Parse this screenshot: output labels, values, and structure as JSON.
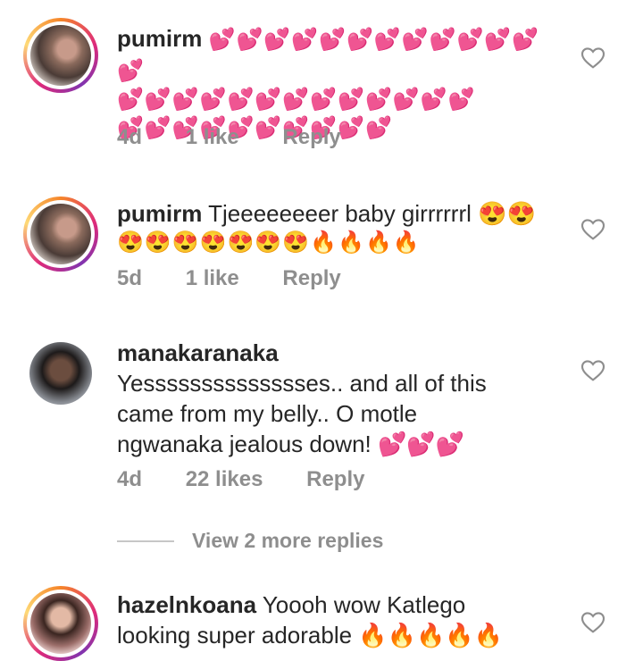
{
  "comments": [
    {
      "username": "pumirm",
      "text": "",
      "emoji_lines": [
        "💕💕💕💕💕💕💕💕💕💕💕💕💕",
        "💕💕💕💕💕💕💕💕💕💕💕💕💕",
        "💕💕💕💕💕💕💕💕💕💕"
      ],
      "time": "4d",
      "likes": "1 like",
      "reply_label": "Reply"
    },
    {
      "username": "pumirm",
      "text": "Tjeeeeeeeer baby girrrrrrl 😍😍",
      "emoji_lines": [
        "😍😍😍😍😍😍😍🔥🔥🔥🔥"
      ],
      "time": "5d",
      "likes": "1 like",
      "reply_label": "Reply"
    },
    {
      "username": "manakaranaka",
      "text": "Yesssssssssssssses.. and all of this came from my belly.. O motle ngwanaka jealous down! 💕💕💕",
      "emoji_lines": [],
      "time": "4d",
      "likes": "22 likes",
      "reply_label": "Reply"
    },
    {
      "username": "hazelnkoana",
      "text": "Yoooh wow Katlego looking super adorable 🔥🔥🔥🔥🔥",
      "emoji_lines": [],
      "time": "",
      "likes": "",
      "reply_label": ""
    }
  ],
  "view_more_replies": "View 2 more replies",
  "icons": {
    "like": "heart-outline-icon",
    "avatar": "user-avatar"
  },
  "colors": {
    "meta": "#8e8e8e",
    "text": "#262626",
    "heart_emoji": "#e8509b"
  }
}
